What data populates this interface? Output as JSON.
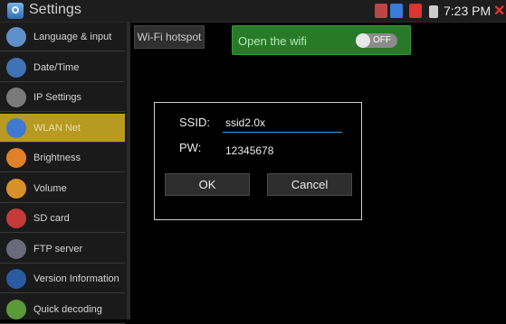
{
  "status_bar": {
    "app_title": "Settings",
    "time": "7:23 PM"
  },
  "sidebar": {
    "items": [
      {
        "label": "Language & input",
        "icon": "language-icon",
        "color": "#5f8fc9"
      },
      {
        "label": "Date/Time",
        "icon": "calendar-icon",
        "color": "#3f73b3"
      },
      {
        "label": "IP Settings",
        "icon": "globe-icon",
        "color": "#7a7a7a"
      },
      {
        "label": "WLAN Net",
        "icon": "wifi-icon",
        "color": "#3f7ad0",
        "active": true
      },
      {
        "label": "Brightness",
        "icon": "brightness-icon",
        "color": "#e0802a"
      },
      {
        "label": "Volume",
        "icon": "speaker-icon",
        "color": "#d8902a"
      },
      {
        "label": "SD card",
        "icon": "sd-card-icon",
        "color": "#c43a3a"
      },
      {
        "label": "FTP server",
        "icon": "ftp-icon",
        "color": "#6a6a7a"
      },
      {
        "label": "Version Information",
        "icon": "info-icon",
        "color": "#2a5aa0"
      },
      {
        "label": "Quick decoding",
        "icon": "decode-icon",
        "color": "#5a9a3a"
      }
    ],
    "active_color": "#b89a22"
  },
  "main": {
    "hotspot_button": "Wi-Fi hotspot",
    "wifi_panel": {
      "label": "Open the wifi",
      "switch_state": "OFF",
      "color": "#287a29"
    }
  },
  "dialog": {
    "ssid_label": "SSID:",
    "ssid_value": "ssid2.0x",
    "pw_label": "PW:",
    "pw_value": "12345678",
    "ok_label": "OK",
    "cancel_label": "Cancel"
  }
}
